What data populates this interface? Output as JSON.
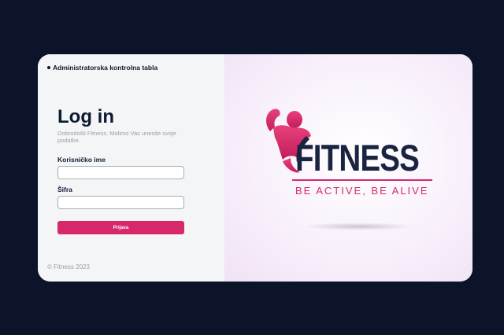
{
  "breadcrumb": {
    "label": "Administratorska kontrolna tabla"
  },
  "login": {
    "title": "Log in",
    "subtitle": "Dobrodošli Fitness. Molimo Vas unesite svoje podatke.",
    "username_label": "Korisničko ime",
    "username_value": "",
    "password_label": "Šifra",
    "password_value": "",
    "submit_label": "Prijava"
  },
  "footer": {
    "copyright": "© Fitness 2023"
  },
  "logo": {
    "word": "FITNESS",
    "tagline": "BE ACTIVE, BE ALIVE",
    "icon": "flexing-athlete-icon"
  },
  "colors": {
    "page_bg": "#0b1428",
    "accent": "#d6286a",
    "heading": "#0d1a33",
    "logo_text": "#1a2340"
  }
}
